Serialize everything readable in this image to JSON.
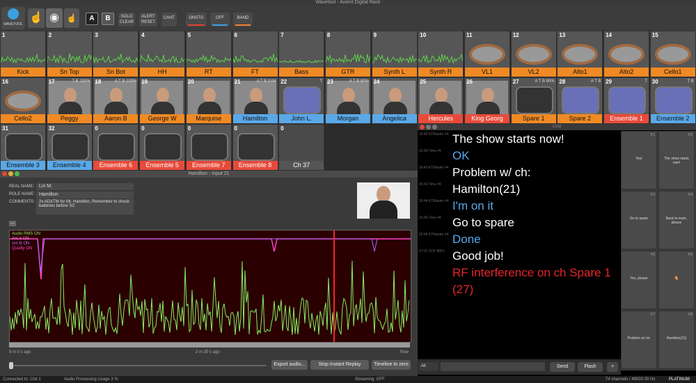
{
  "app": {
    "title": "Wavetool - Avient Digital Rack"
  },
  "toolbar": {
    "logo_label": "WAVETOOL",
    "a_label": "A",
    "b_label": "B",
    "solo_clear": "SOLO CLEAR",
    "alert_reset": "ALERT RESET",
    "chat": "CHAT",
    "onstg": "ONSTG",
    "off": "OFF",
    "band": "BAND",
    "colors": {
      "onstg": "#e04030",
      "off": "#3aa0e0",
      "band": "#f08030"
    }
  },
  "channels": [
    {
      "num": "1",
      "label": "Kick",
      "color": "#f08a24",
      "kind": "wave"
    },
    {
      "num": "2",
      "label": "Sn Top",
      "color": "#f08a24",
      "kind": "wave"
    },
    {
      "num": "3",
      "label": "Sn Bot",
      "color": "#f08a24",
      "kind": "wave"
    },
    {
      "num": "4",
      "label": "HH",
      "color": "#f08a24",
      "kind": "wave"
    },
    {
      "num": "5",
      "label": "RT",
      "color": "#f08a24",
      "kind": "wave"
    },
    {
      "num": "6",
      "label": "FT",
      "color": "#f08a24",
      "kind": "wave"
    },
    {
      "num": "7",
      "label": "Bass",
      "color": "#f08a24",
      "kind": "wave"
    },
    {
      "num": "8",
      "label": "GTR",
      "color": "#f08a24",
      "kind": "wave"
    },
    {
      "num": "9",
      "label": "Synth L",
      "color": "#f08a24",
      "kind": "wave"
    },
    {
      "num": "10",
      "label": "Synth R",
      "color": "#f08a24",
      "kind": "wave"
    },
    {
      "num": "11",
      "label": "VL1",
      "color": "#f08a24",
      "kind": "cable"
    },
    {
      "num": "12",
      "label": "VL2",
      "color": "#f08a24",
      "kind": "cable"
    },
    {
      "num": "13",
      "label": "Alto1",
      "color": "#f08a24",
      "kind": "cable"
    },
    {
      "num": "14",
      "label": "Alto2",
      "color": "#f08a24",
      "kind": "cable"
    },
    {
      "num": "15",
      "label": "Cello1",
      "color": "#f08a24",
      "kind": "cable"
    },
    {
      "num": "16",
      "label": "Cello2",
      "color": "#f08a24",
      "kind": "cable"
    },
    {
      "num": "17",
      "label": "Peggy",
      "color": "#f08a24",
      "kind": "person",
      "bat": "T B 100%"
    },
    {
      "num": "18",
      "label": "Aaron B",
      "color": "#f08a24",
      "kind": "person",
      "bat": "A T B 100%"
    },
    {
      "num": "19",
      "label": "George W",
      "color": "#f08a24",
      "kind": "person"
    },
    {
      "num": "20",
      "label": "Marquise",
      "color": "#f08a24",
      "kind": "person"
    },
    {
      "num": "21",
      "label": "Hamilton",
      "color": "#5aa8e8",
      "kind": "person",
      "bat": "A T B 3:04"
    },
    {
      "num": "22",
      "label": "John L.",
      "color": "#5aa8e8",
      "kind": "blue",
      "bat": "T"
    },
    {
      "num": "23",
      "label": "Morgan",
      "color": "#5aa8e8",
      "kind": "person",
      "bat": "A T B 80%"
    },
    {
      "num": "24",
      "label": "Angelica",
      "color": "#5aa8e8",
      "kind": "person"
    },
    {
      "num": "25",
      "label": "Hercules",
      "color": "#e84a3a",
      "kind": "person"
    },
    {
      "num": "26",
      "label": "King Georg",
      "color": "#e84a3a",
      "kind": "person"
    },
    {
      "num": "27",
      "label": "Spare 1",
      "color": "#f08a24",
      "kind": "pack",
      "bat": "A T B 80%"
    },
    {
      "num": "28",
      "label": "Spare 2",
      "color": "#f08a24",
      "kind": "blue",
      "bat": "A T B"
    },
    {
      "num": "29",
      "label": "Ensemble 1",
      "color": "#e84a3a",
      "kind": "blue",
      "bat": "T"
    },
    {
      "num": "30",
      "label": "Ensemble 2",
      "color": "#5aa8e8",
      "kind": "blue",
      "bat": "T B"
    },
    {
      "num": "31",
      "label": "Ensemble 3",
      "color": "#5aa8e8",
      "kind": "pack"
    },
    {
      "num": "32",
      "label": "Ensemble 4",
      "color": "#5aa8e8",
      "kind": "pack"
    },
    {
      "num": "0",
      "label": "Ensemble 6",
      "color": "#e84a3a",
      "kind": "pack"
    },
    {
      "num": "0",
      "label": "Ensemble 5",
      "color": "#e84a3a",
      "kind": "pack"
    },
    {
      "num": "0",
      "label": "Ensemble 7",
      "color": "#e84a3a",
      "kind": "pack"
    },
    {
      "num": "0",
      "label": "Ensemble 8",
      "color": "#e84a3a",
      "kind": "pack"
    },
    {
      "num": "0",
      "label": "Ch 37",
      "color": "#666666",
      "kind": "empty"
    }
  ],
  "hamilton": {
    "title": "Hamilton - Input 21",
    "real_name_label": "REAL NAME:",
    "real_name": "Lin M.",
    "role_name_label": "ROLE NAME:",
    "role_name": "Hamilton",
    "comments_label": "COMMENTS:",
    "comments": "2x ADXTM for Mr. Hamilton, Remember to check batteries before SC",
    "collapse": "—",
    "legend": [
      "Audio RMS ON",
      "Ant A ON",
      "Ant B ON",
      "Quality ON"
    ],
    "legend_colors": [
      "#88ee66",
      "#ee88cc",
      "#aa66ff",
      "#ff44cc"
    ],
    "t_left": "5 m 0 s ago",
    "t_mid": "2 m 30 s ago",
    "t_right": "Now",
    "export": "Export audio...",
    "stop": "Stop Instant Replay",
    "timeline": "Timeline to zero"
  },
  "chat": {
    "title": "Chat",
    "messages": [
      {
        "text": "The show starts now!",
        "color": "#ffffff",
        "meta": "16:43 KTMaster #4"
      },
      {
        "text": "OK",
        "color": "#5aa8e8",
        "meta": "16:43 Time #4"
      },
      {
        "text": "Problem w/ ch:",
        "color": "#ffffff",
        "meta": "16:43 KTMaster #4"
      },
      {
        "text": "Hamilton(21)",
        "color": "#ffffff",
        "meta": "16:43 Time #4"
      },
      {
        "text": "I'm on it",
        "color": "#5aa8e8",
        "meta": "16:44 KTMaster #4"
      },
      {
        "text": "Go to spare",
        "color": "#ffffff",
        "meta": "16:44 Time #4"
      },
      {
        "text": "Done",
        "color": "#5aa8e8",
        "meta": "16:44 KTMaster #4"
      },
      {
        "text": "Good job!",
        "color": "#ffffff",
        "meta": "17:01 SCP 8801"
      },
      {
        "text": "RF interference on ch Spare 1",
        "color": "#e8242a",
        "meta": ""
      },
      {
        "text": "(27)",
        "color": "#e8242a",
        "meta": ""
      }
    ],
    "quick": [
      {
        "key": "F1",
        "text": "Yes!"
      },
      {
        "key": "F2",
        "text": "The show starts now!"
      },
      {
        "key": "F3",
        "text": "Go to spare"
      },
      {
        "key": "F4",
        "text": "Back to main, please"
      },
      {
        "key": "F5",
        "text": "Yes, please"
      },
      {
        "key": "F6",
        "text": "🍕"
      },
      {
        "key": "F7",
        "text": "Problem w/ ch:"
      },
      {
        "key": "F8",
        "text": "Hamilton(21)"
      }
    ],
    "recipient": "All",
    "send": "Send",
    "flash": "Flash",
    "more": "+"
  },
  "status": {
    "connected": "Connected to: Clnt 1",
    "usage": "Audio Processing Usage 3 %",
    "streaming": "Streaming: OFF",
    "channels": "74 channels / 48000.00 Hz",
    "tier": "PLATINUM"
  }
}
